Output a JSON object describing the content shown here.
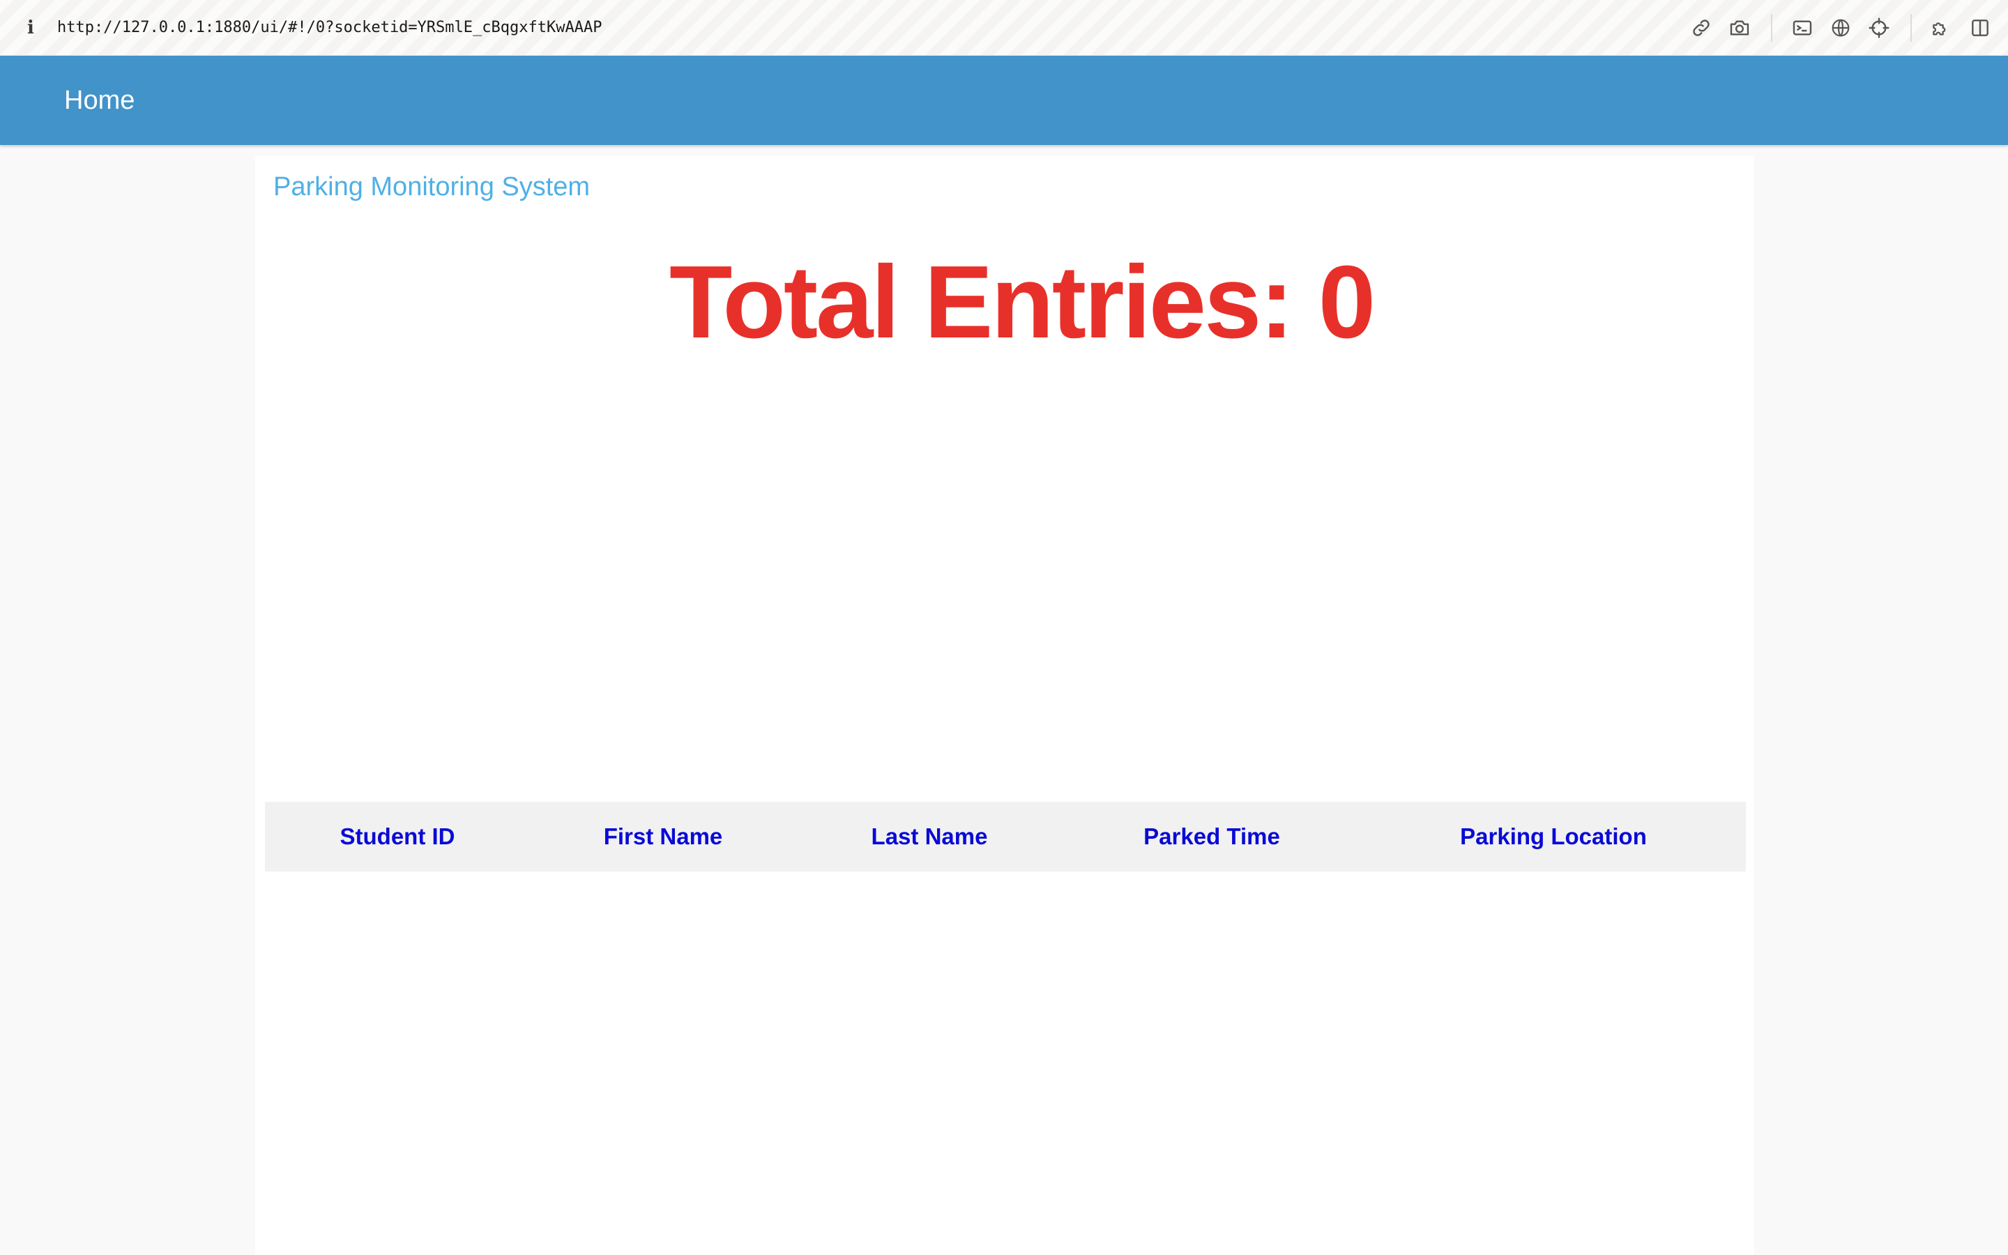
{
  "browser": {
    "url": "http://127.0.0.1:1880/ui/#!/0?socketid=YRSmlE_cBqgxftKwAAAP",
    "info_glyph": "i",
    "toolbar_icons": [
      "link-icon",
      "camera-icon",
      "terminal-icon",
      "globe-icon",
      "crosshair-icon",
      "extension-icon",
      "sidebar-icon"
    ]
  },
  "header": {
    "title": "Home",
    "background": "#4193c9"
  },
  "dashboard": {
    "group_title": "Parking Monitoring System",
    "total_entries": "Total Entries: 0",
    "total_color": "#e8302a"
  },
  "table": {
    "columns": [
      "Student ID",
      "First Name",
      "Last Name",
      "Parked Time",
      "Parking Location"
    ],
    "rows": [],
    "header_color": "#0a0ad6"
  }
}
